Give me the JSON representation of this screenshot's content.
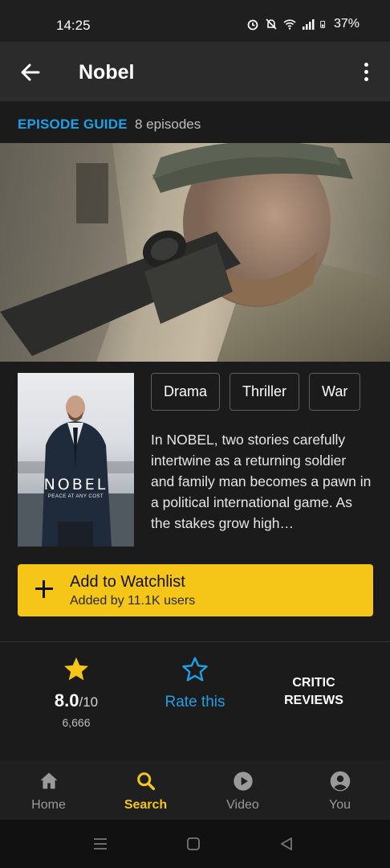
{
  "status_bar": {
    "time": "14:25",
    "battery": "37%",
    "icons": [
      "alarm-icon",
      "bell-off-icon",
      "wifi-icon",
      "signal-icon",
      "battery-icon"
    ]
  },
  "app_bar": {
    "title": "Nobel",
    "back_icon": "arrow-left-icon",
    "more_icon": "more-vertical-icon"
  },
  "episode_guide": {
    "label": "EPISODE GUIDE",
    "count": "8 episodes"
  },
  "poster": {
    "title": "NOBEL",
    "tagline": "PEACE AT ANY COST"
  },
  "genres": [
    "Drama",
    "Thriller",
    "War"
  ],
  "plot": "In NOBEL, two stories carefully intertwine as a returning soldier and family man becomes a pawn in a political international game. As the stakes grow high…",
  "watchlist": {
    "title": "Add to Watchlist",
    "subtitle": "Added by 11.1K users"
  },
  "ratings": {
    "imdb_rating": "8.0",
    "imdb_scale": "/10",
    "vote_count": "6,666",
    "rate_label": "Rate this",
    "critic_label_line1": "CRITIC",
    "critic_label_line2": "REVIEWS"
  },
  "bottom_nav": [
    {
      "label": "Home",
      "icon": "home-icon",
      "active": false
    },
    {
      "label": "Search",
      "icon": "search-icon",
      "active": true
    },
    {
      "label": "Video",
      "icon": "play-circle-icon",
      "active": false
    },
    {
      "label": "You",
      "icon": "account-circle-icon",
      "active": false
    }
  ],
  "colors": {
    "accent_yellow": "#f5c518",
    "link_blue": "#1ea0e6",
    "background": "#1b1b1b"
  }
}
